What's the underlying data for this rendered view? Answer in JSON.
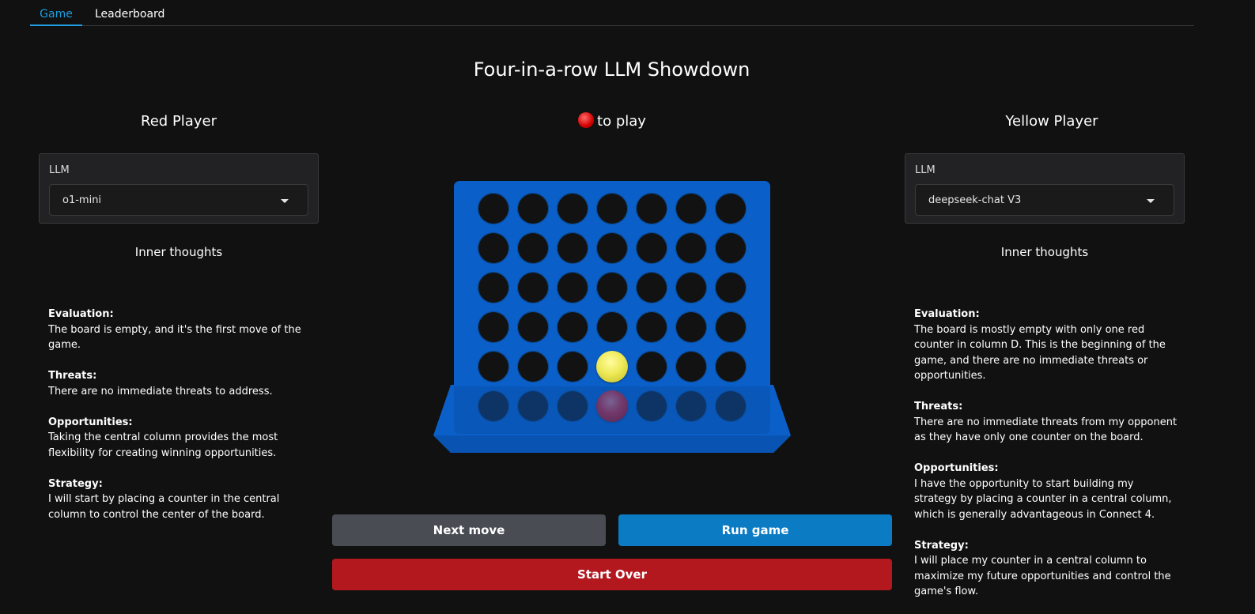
{
  "tabs": [
    {
      "label": "Game",
      "active": true
    },
    {
      "label": "Leaderboard",
      "active": false
    }
  ],
  "title": "Four-in-a-row LLM Showdown",
  "turn_text": "to play",
  "turn_color": "red",
  "red_player": {
    "heading": "Red Player",
    "llm_label": "LLM",
    "llm_value": "o1-mini",
    "thoughts_heading": "Inner thoughts",
    "thoughts": [
      {
        "heading": "Evaluation:",
        "text": "The board is empty, and it's the first move of the game."
      },
      {
        "heading": "Threats:",
        "text": "There are no immediate threats to address."
      },
      {
        "heading": "Opportunities:",
        "text": "Taking the central column provides the most flexibility for creating winning opportunities."
      },
      {
        "heading": "Strategy:",
        "text": "I will start by placing a counter in the central column to control the center of the board."
      }
    ]
  },
  "yellow_player": {
    "heading": "Yellow Player",
    "llm_label": "LLM",
    "llm_value": "deepseek-chat V3",
    "thoughts_heading": "Inner thoughts",
    "thoughts": [
      {
        "heading": "Evaluation:",
        "text": "The board is mostly empty with only one red counter in column D. This is the beginning of the game, and there are no immediate threats or opportunities."
      },
      {
        "heading": "Threats:",
        "text": "There are no immediate threats from my opponent as they have only one counter on the board."
      },
      {
        "heading": "Opportunities:",
        "text": "I have the opportunity to start building my strategy by placing a counter in a central column, which is generally advantageous in Connect 4."
      },
      {
        "heading": "Strategy:",
        "text": "I will place my counter in a central column to maximize my future opportunities and control the game's flow."
      }
    ]
  },
  "board": {
    "rows": 6,
    "cols": 7,
    "cells": [
      [
        "",
        "",
        "",
        "",
        "",
        "",
        ""
      ],
      [
        "",
        "",
        "",
        "",
        "",
        "",
        ""
      ],
      [
        "",
        "",
        "",
        "",
        "",
        "",
        ""
      ],
      [
        "",
        "",
        "",
        "",
        "",
        "",
        ""
      ],
      [
        "",
        "",
        "",
        "yellow",
        "",
        "",
        ""
      ],
      [
        "",
        "",
        "",
        "red",
        "",
        "",
        ""
      ]
    ],
    "colors": {
      "board": "#0a5fc9",
      "red": "#f01b1b",
      "yellow": "#eeea58",
      "empty": "#121212"
    }
  },
  "buttons": {
    "next_move": "Next move",
    "run_game": "Run game",
    "start_over": "Start Over"
  }
}
